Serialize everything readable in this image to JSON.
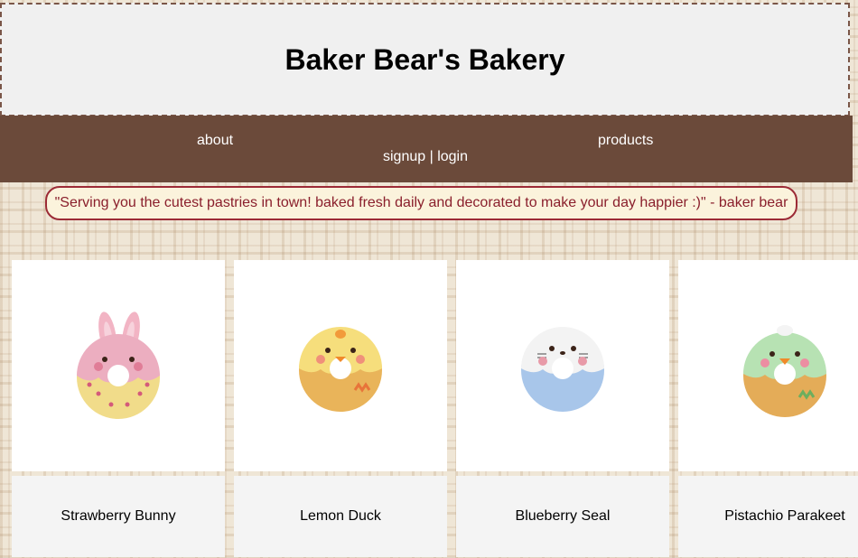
{
  "site": {
    "title": "Baker Bear's Bakery"
  },
  "nav": {
    "about": "about",
    "products": "products",
    "account": "signup | login"
  },
  "tagline": "\"Serving you the cutest pastries in town! baked fresh daily and decorated to make your day happier :)\" - baker bear",
  "products": [
    {
      "name": "Strawberry Bunny",
      "icon": "bunny-donut"
    },
    {
      "name": "Lemon Duck",
      "icon": "duck-donut"
    },
    {
      "name": "Blueberry Seal",
      "icon": "seal-donut"
    },
    {
      "name": "Pistachio Parakeet",
      "icon": "parakeet-donut"
    }
  ],
  "colors": {
    "nav_bg": "#6b4a3a",
    "quote_border": "#9c2b36",
    "quote_text": "#8a1f2c"
  }
}
